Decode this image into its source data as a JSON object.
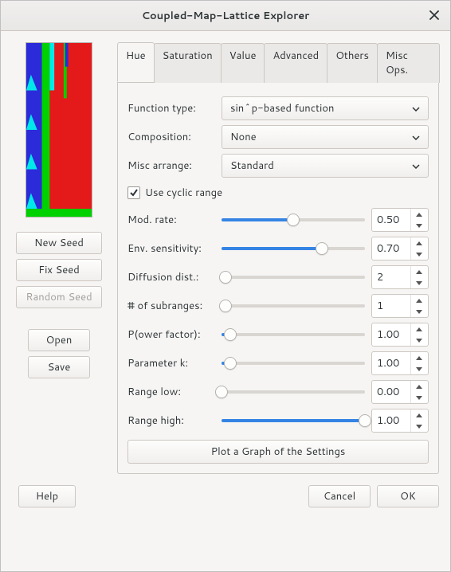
{
  "window": {
    "title": "Coupled-Map-Lattice Explorer"
  },
  "left": {
    "new_seed": "New Seed",
    "fix_seed": "Fix Seed",
    "random_seed": "Random Seed",
    "open": "Open",
    "save": "Save"
  },
  "tabs": [
    {
      "label": "Hue"
    },
    {
      "label": "Saturation"
    },
    {
      "label": "Value"
    },
    {
      "label": "Advanced"
    },
    {
      "label": "Others"
    },
    {
      "label": "Misc Ops."
    }
  ],
  "hue": {
    "function_type": {
      "label": "Function type:",
      "value": "sin^p-based function"
    },
    "composition": {
      "label": "Composition:",
      "value": "None"
    },
    "misc_arrange": {
      "label": "Misc arrange:",
      "value": "Standard"
    },
    "use_cyclic": {
      "label": "Use cyclic range",
      "checked": true
    },
    "sliders": [
      {
        "label": "Mod. rate:",
        "value": "0.50",
        "frac": 0.5
      },
      {
        "label": "Env. sensitivity:",
        "value": "0.70",
        "frac": 0.7
      },
      {
        "label": "Diffusion dist.:",
        "value": "2",
        "frac": 0.03
      },
      {
        "label": "# of subranges:",
        "value": "1",
        "frac": 0.03
      },
      {
        "label": "P(ower factor):",
        "value": "1.00",
        "frac": 0.06
      },
      {
        "label": "Parameter k:",
        "value": "1.00",
        "frac": 0.06
      },
      {
        "label": "Range low:",
        "value": "0.00",
        "frac": 0.0
      },
      {
        "label": "Range high:",
        "value": "1.00",
        "frac": 1.0
      }
    ],
    "plot_btn": "Plot a Graph of the Settings"
  },
  "footer": {
    "help": "Help",
    "cancel": "Cancel",
    "ok": "OK"
  }
}
